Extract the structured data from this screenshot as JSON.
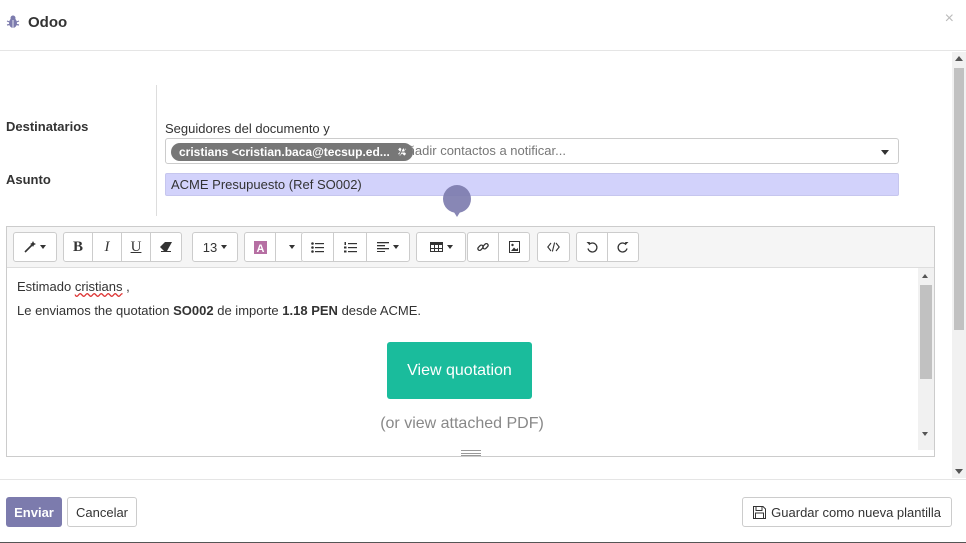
{
  "dialog": {
    "title": "Odoo",
    "close_glyph": "×"
  },
  "form": {
    "recipients_label": "Destinatarios",
    "followers_text": "Seguidores del documento y",
    "recipient_tag": "cristians <cristian.baca@tecsup.ed...",
    "recipient_placeholder": "Añadir contactos a notificar...",
    "subject_label": "Asunto",
    "subject_value": "ACME Presupuesto (Ref SO002)"
  },
  "toolbar": {
    "style_icon": "magic-wand-icon",
    "bold": "B",
    "italic": "I",
    "underline": "U",
    "eraser_icon": "eraser-icon",
    "font_size": "13",
    "font_color_icon": "font-color-icon",
    "unordered_list_icon": "bullet-list-icon",
    "ordered_list_icon": "numbered-list-icon",
    "align_icon": "align-left-icon",
    "table_icon": "table-icon",
    "link_icon": "link-icon",
    "image_icon": "image-icon",
    "code_view_icon": "code-view-icon",
    "undo_icon": "undo-icon",
    "redo_icon": "redo-icon"
  },
  "body": {
    "greeting_prefix": "Estimado",
    "greeting_name": "cristians",
    "greeting_suffix": ",",
    "line_part1": "Le enviamos the quotation",
    "order_ref": "SO002",
    "line_part2": "de importe",
    "amount": "1.18 PEN",
    "line_part3": "desde ACME.",
    "cta_label": "View quotation",
    "pdf_note": "(or view attached PDF)"
  },
  "footer": {
    "send_label": "Enviar",
    "cancel_label": "Cancelar",
    "save_template_label": "Guardar como nueva plantilla"
  },
  "colors": {
    "primary": "#7c7bad",
    "cta": "#1abc9c",
    "subject_bg": "#d2d2fb",
    "tag_bg": "#777777"
  }
}
